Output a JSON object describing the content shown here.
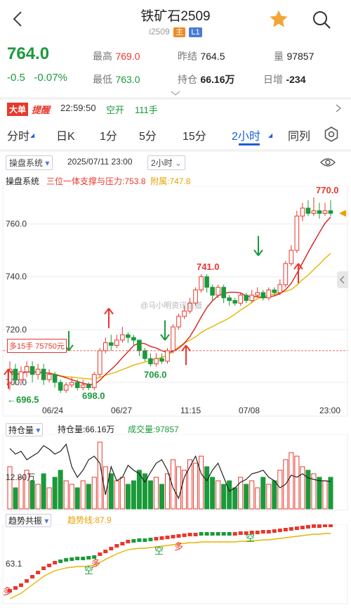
{
  "header": {
    "title": "铁矿石2509",
    "code": "i2509",
    "badge_main": "主",
    "badge_l1": "L1"
  },
  "quote": {
    "price": "764.0",
    "change": "-0.5",
    "change_pct": "-0.07%",
    "high_label": "最高",
    "high": "769.0",
    "low_label": "最低",
    "low": "763.0",
    "prev_label": "昨结",
    "prev": "764.5",
    "oi_label": "持仓",
    "oi": "66.16万",
    "vol_label": "量",
    "vol": "97857",
    "daily_label": "日增",
    "daily": "-234"
  },
  "alert": {
    "tag1": "大单",
    "tag2": "提醒",
    "time": "22:59:50",
    "action": "空开",
    "lots": "111手"
  },
  "tabs": [
    "分时",
    "日K",
    "1分",
    "5分",
    "15分",
    "2小时",
    "同列"
  ],
  "active_tab": "2小时",
  "toolbar": {
    "indicator": "操盘系统",
    "datetime": "2025/07/11 23:00",
    "period": "2小时"
  },
  "legend": {
    "name": "操盘系统",
    "support": "三位一体支撑与压力:753.8",
    "attach": "附属:747.8"
  },
  "chart_data": [
    {
      "type": "candlestick",
      "y_ticks": [
        "760.0",
        "740.0",
        "720.0",
        "700.0"
      ],
      "x_ticks": [
        "06/24",
        "06/27",
        "11:15",
        "07/08",
        "23:00"
      ],
      "annotations": [
        "770.0",
        "741.0",
        "706.0",
        "698.0",
        "696.5"
      ],
      "position_label": "多15手 75750元",
      "watermark": "@马小明资讯信道",
      "candles": [
        {
          "o": 700,
          "c": 705,
          "h": 708,
          "l": 697
        },
        {
          "o": 705,
          "c": 701,
          "h": 707,
          "l": 699
        },
        {
          "o": 701,
          "c": 704,
          "h": 706,
          "l": 699
        },
        {
          "o": 704,
          "c": 706,
          "h": 708,
          "l": 702
        },
        {
          "o": 706,
          "c": 703,
          "h": 708,
          "l": 700
        },
        {
          "o": 703,
          "c": 705,
          "h": 707,
          "l": 701
        },
        {
          "o": 705,
          "c": 701,
          "h": 707,
          "l": 699
        },
        {
          "o": 701,
          "c": 703,
          "h": 705,
          "l": 700
        },
        {
          "o": 703,
          "c": 700,
          "h": 704,
          "l": 698
        },
        {
          "o": 700,
          "c": 697,
          "h": 701,
          "l": 696
        },
        {
          "o": 697,
          "c": 699,
          "h": 700,
          "l": 696
        },
        {
          "o": 699,
          "c": 700,
          "h": 702,
          "l": 698
        },
        {
          "o": 700,
          "c": 698,
          "h": 701,
          "l": 697
        },
        {
          "o": 698,
          "c": 699,
          "h": 701,
          "l": 697
        },
        {
          "o": 699,
          "c": 698,
          "h": 700,
          "l": 697
        },
        {
          "o": 698,
          "c": 703,
          "h": 704,
          "l": 697
        },
        {
          "o": 703,
          "c": 712,
          "h": 713,
          "l": 702
        },
        {
          "o": 712,
          "c": 715,
          "h": 717,
          "l": 711
        },
        {
          "o": 715,
          "c": 714,
          "h": 718,
          "l": 712
        },
        {
          "o": 714,
          "c": 716,
          "h": 718,
          "l": 713
        },
        {
          "o": 716,
          "c": 718,
          "h": 721,
          "l": 715
        },
        {
          "o": 718,
          "c": 717,
          "h": 719,
          "l": 715
        },
        {
          "o": 717,
          "c": 716,
          "h": 718,
          "l": 714
        },
        {
          "o": 716,
          "c": 712,
          "h": 716,
          "l": 710
        },
        {
          "o": 712,
          "c": 709,
          "h": 713,
          "l": 708
        },
        {
          "o": 709,
          "c": 707,
          "h": 711,
          "l": 706
        },
        {
          "o": 707,
          "c": 709,
          "h": 711,
          "l": 706
        },
        {
          "o": 709,
          "c": 708,
          "h": 711,
          "l": 707
        },
        {
          "o": 708,
          "c": 712,
          "h": 713,
          "l": 707
        },
        {
          "o": 712,
          "c": 721,
          "h": 722,
          "l": 711
        },
        {
          "o": 721,
          "c": 725,
          "h": 726,
          "l": 720
        },
        {
          "o": 725,
          "c": 727,
          "h": 729,
          "l": 724
        },
        {
          "o": 727,
          "c": 730,
          "h": 732,
          "l": 726
        },
        {
          "o": 730,
          "c": 735,
          "h": 736,
          "l": 729
        },
        {
          "o": 735,
          "c": 740,
          "h": 741,
          "l": 734
        },
        {
          "o": 740,
          "c": 736,
          "h": 741,
          "l": 734
        },
        {
          "o": 736,
          "c": 733,
          "h": 737,
          "l": 731
        },
        {
          "o": 733,
          "c": 736,
          "h": 737,
          "l": 732
        },
        {
          "o": 736,
          "c": 732,
          "h": 737,
          "l": 730
        },
        {
          "o": 732,
          "c": 731,
          "h": 733,
          "l": 729
        },
        {
          "o": 731,
          "c": 730,
          "h": 732,
          "l": 729
        },
        {
          "o": 730,
          "c": 733,
          "h": 734,
          "l": 729
        },
        {
          "o": 733,
          "c": 731,
          "h": 734,
          "l": 730
        },
        {
          "o": 731,
          "c": 733,
          "h": 735,
          "l": 730
        },
        {
          "o": 733,
          "c": 734,
          "h": 736,
          "l": 732
        },
        {
          "o": 734,
          "c": 732,
          "h": 735,
          "l": 731
        },
        {
          "o": 732,
          "c": 735,
          "h": 736,
          "l": 731
        },
        {
          "o": 735,
          "c": 734,
          "h": 736,
          "l": 733
        },
        {
          "o": 734,
          "c": 737,
          "h": 739,
          "l": 733
        },
        {
          "o": 737,
          "c": 745,
          "h": 746,
          "l": 736
        },
        {
          "o": 745,
          "c": 750,
          "h": 752,
          "l": 744
        },
        {
          "o": 750,
          "c": 763,
          "h": 765,
          "l": 749
        },
        {
          "o": 763,
          "c": 766,
          "h": 768,
          "l": 761
        },
        {
          "o": 766,
          "c": 764,
          "h": 769,
          "l": 763
        },
        {
          "o": 764,
          "c": 765,
          "h": 770,
          "l": 763
        },
        {
          "o": 765,
          "c": 764,
          "h": 768,
          "l": 762
        },
        {
          "o": 764,
          "c": 765,
          "h": 768,
          "l": 763
        },
        {
          "o": 765,
          "c": 764,
          "h": 769,
          "l": 763
        }
      ]
    },
    {
      "type": "bar",
      "title": "持仓量",
      "label_oi": "持仓量:66.16万",
      "label_vol": "成交量:97857",
      "y_tick": "12.80万",
      "volumes": [
        60,
        30,
        45,
        55,
        40,
        35,
        50,
        30,
        45,
        55,
        40,
        35,
        30,
        40,
        35,
        45,
        95,
        60,
        50,
        40,
        45,
        35,
        40,
        55,
        50,
        40,
        45,
        35,
        50,
        70,
        60,
        55,
        70,
        65,
        75,
        60,
        45,
        40,
        35,
        40,
        30,
        45,
        35,
        40,
        30,
        45,
        35,
        40,
        55,
        70,
        80,
        75,
        60,
        55,
        50,
        45,
        40,
        45
      ]
    },
    {
      "type": "line",
      "title": "趋势共振",
      "label": "趋势线:87.9",
      "y_tick": "63.1",
      "markers": [
        "空",
        "多",
        "空",
        "多",
        "空"
      ],
      "values": [
        10,
        14,
        18,
        24,
        30,
        36,
        42,
        46,
        50,
        52,
        54,
        55,
        56,
        56,
        57,
        58,
        62,
        66,
        70,
        74,
        77,
        80,
        81,
        82,
        82,
        83,
        84,
        85,
        86,
        87,
        88,
        89,
        90,
        90,
        91,
        91,
        91,
        91,
        91,
        91,
        91,
        92,
        92,
        93,
        93,
        94,
        94,
        95,
        96,
        97,
        98,
        99,
        100,
        101,
        102,
        102,
        103,
        103
      ]
    }
  ]
}
